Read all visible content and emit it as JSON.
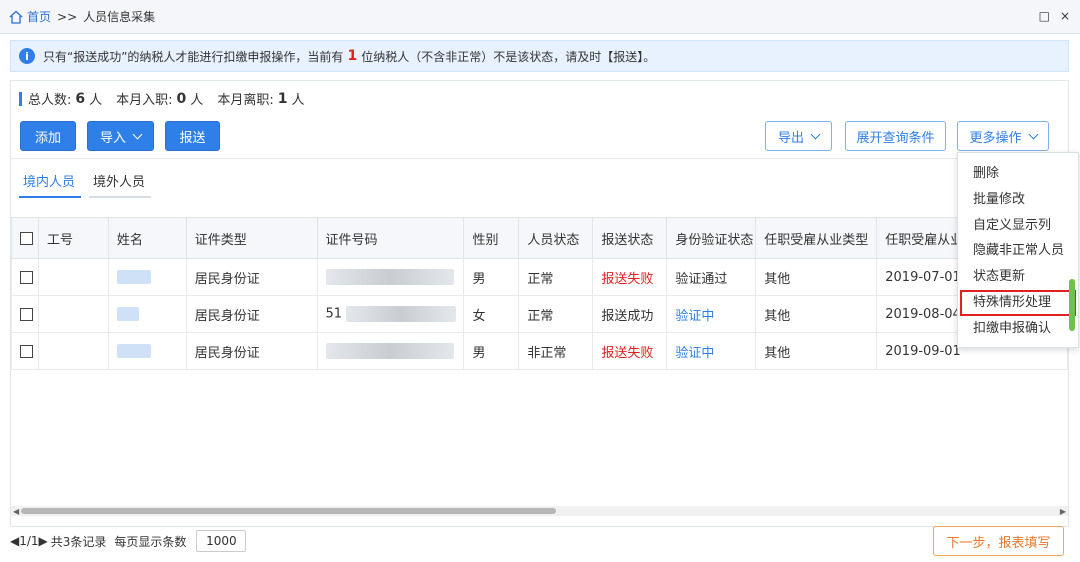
{
  "breadcrumb": {
    "home": "首页",
    "sep": ">>",
    "current": "人员信息采集"
  },
  "window_buttons": {
    "restore": "□",
    "close": "×"
  },
  "notice": {
    "prefix": "只有“报送成功”的纳税人才能进行扣缴申报操作，当前有",
    "count": "1",
    "suffix": "位纳税人（不含非正常）不是该状态，请及时【报送】。"
  },
  "stats": {
    "total_label": "总人数:",
    "total": "6",
    "unit": "人",
    "join_label": "本月入职:",
    "join": "0",
    "leave_label": "本月离职:",
    "leave": "1"
  },
  "buttons": {
    "add": "添加",
    "import": "导入",
    "submit": "报送",
    "export": "导出",
    "expand": "展开查询条件",
    "more": "更多操作"
  },
  "tabs": [
    "境内人员",
    "境外人员"
  ],
  "table": {
    "headers": [
      "工号",
      "姓名",
      "证件类型",
      "证件号码",
      "性别",
      "人员状态",
      "报送状态",
      "身份验证状态",
      "任职受雇从业类型",
      "任职受雇从业"
    ],
    "rows": [
      {
        "id_type": "居民身份证",
        "id_no": "",
        "gender": "男",
        "status": "正常",
        "report": "报送失败",
        "verify": "验证通过",
        "job_type": "其他",
        "date": "2019-07-01"
      },
      {
        "id_type": "居民身份证",
        "id_no": "51",
        "gender": "女",
        "status": "正常",
        "report": "报送成功",
        "verify": "验证中",
        "job_type": "其他",
        "date": "2019-08-04"
      },
      {
        "id_type": "居民身份证",
        "id_no": "",
        "gender": "男",
        "status": "非正常",
        "report": "报送失败",
        "verify": "验证中",
        "job_type": "其他",
        "date": "2019-09-01"
      }
    ]
  },
  "menu": [
    "删除",
    "批量修改",
    "自定义显示列",
    "隐藏非正常人员",
    "状态更新",
    "特殊情形处理",
    "扣缴申报确认"
  ],
  "pager": {
    "page": "1/1",
    "records": "共3条记录",
    "per_page_label": "每页显示条数",
    "per_page": "1000"
  },
  "next_button": "下一步，报表填写",
  "colors": {
    "primary": "#2f7fe8",
    "danger": "#e02020",
    "orange": "#e8782a"
  }
}
